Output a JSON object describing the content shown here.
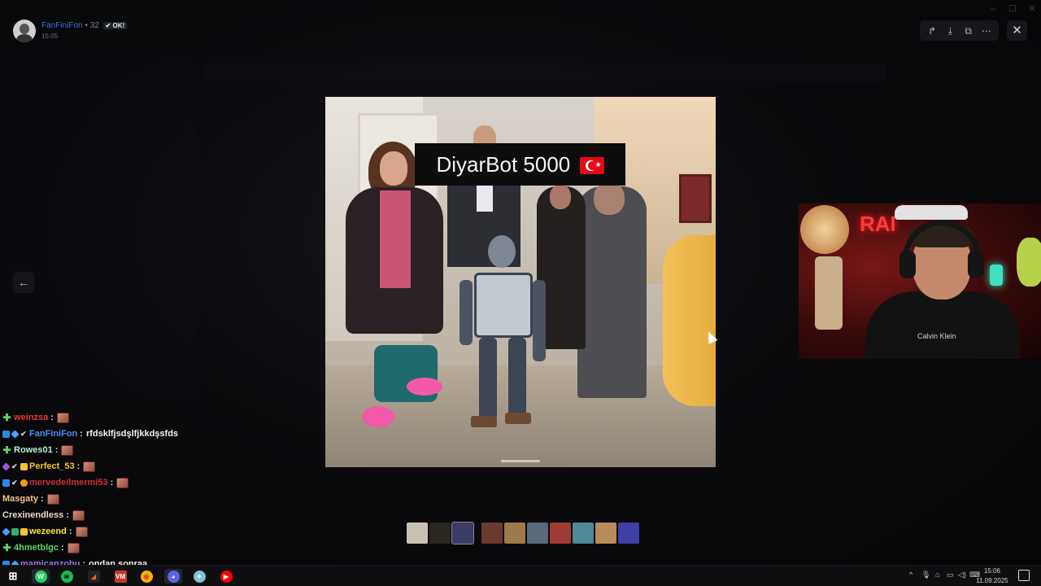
{
  "window": {
    "minimize_label": "–",
    "maximize_label": "☐",
    "close_label": "✕"
  },
  "viewer": {
    "poster_name": "FanFiniFon",
    "poster_sep": "•",
    "poster_points": "32",
    "poster_badge": "OK!",
    "post_time": "15:05",
    "toolbar_icons": [
      "share-icon",
      "download-icon",
      "open-external-icon",
      "more-icon"
    ],
    "toolbar_glyphs": [
      "↱",
      "⤓",
      "⧉",
      "⋯"
    ],
    "close_glyph": "✕",
    "prev_glyph": "←",
    "caption": "DiyarBot 5000"
  },
  "webcam": {
    "neon_text": "RAI",
    "shirt_logo": "Calvin Klein"
  },
  "thumbnails": [
    {
      "color": "#c9c2b3",
      "gap": false,
      "selected": false
    },
    {
      "color": "#2a2620",
      "gap": false,
      "selected": false
    },
    {
      "color": "#3b3c63",
      "gap": false,
      "selected": true
    },
    {
      "color": "#6b3a2e",
      "gap": true,
      "selected": false
    },
    {
      "color": "#9c7a4a",
      "gap": false,
      "selected": false
    },
    {
      "color": "#5a6a78",
      "gap": false,
      "selected": false
    },
    {
      "color": "#a13a3a",
      "gap": false,
      "selected": false
    },
    {
      "color": "#4e8a9a",
      "gap": false,
      "selected": false
    },
    {
      "color": "#b58c5a",
      "gap": false,
      "selected": false
    },
    {
      "color": "#3f3fa8",
      "gap": false,
      "selected": false
    }
  ],
  "chat": [
    {
      "badges": [
        "plus"
      ],
      "name": "weinzsa",
      "color": "#e8373d",
      "message": "",
      "emote": true
    },
    {
      "badges": [
        "blue",
        "cube",
        "check"
      ],
      "name": "FanFiniFon",
      "color": "#4a8df5",
      "message": "rfdsklfjsdşlfjkkdşsfds",
      "emote": false
    },
    {
      "badges": [
        "plus"
      ],
      "name": "Rowes01",
      "color": "#b5f2d7",
      "message": "",
      "emote": true
    },
    {
      "badges": [
        "purple",
        "check",
        "gold"
      ],
      "name": "Perfect_53",
      "color": "#f3c330",
      "message": "",
      "emote": true
    },
    {
      "badges": [
        "blue",
        "check",
        "orange"
      ],
      "name": "mervedeilmermi53",
      "color": "#d12d3b",
      "message": "",
      "emote": true
    },
    {
      "badges": [],
      "name": "Masgaty",
      "color": "#f3c38a",
      "message": "",
      "emote": true
    },
    {
      "badges": [],
      "name": "Crexinendless",
      "color": "#e9dcc8",
      "message": "",
      "emote": true
    },
    {
      "badges": [
        "cube",
        "green",
        "gold"
      ],
      "name": "wezeend",
      "color": "#f5e63b",
      "message": "",
      "emote": true
    },
    {
      "badges": [
        "plus"
      ],
      "name": "4hmetblgc",
      "color": "#5fd35f",
      "message": "",
      "emote": true
    },
    {
      "badges": [
        "blue",
        "cube"
      ],
      "name": "mamicanzobu",
      "color": "#9b7bf0",
      "message": "ondan sonraa",
      "emote": false
    }
  ],
  "taskbar": {
    "items": [
      {
        "name": "start-button",
        "glyph": "⊞",
        "bg": "transparent",
        "fg": "#ffffff",
        "active": false
      },
      {
        "name": "whatsapp-icon",
        "glyph": "W",
        "bg": "#25d366",
        "fg": "#ffffff",
        "active": true
      },
      {
        "name": "spotify-icon",
        "glyph": "≋",
        "bg": "#1db954",
        "fg": "#000000",
        "active": false
      },
      {
        "name": "capcut-icon",
        "glyph": "◢",
        "bg": "#222222",
        "fg": "#ff5a2a",
        "active": false
      },
      {
        "name": "voicemeeter-icon",
        "glyph": "VM",
        "bg": "#c0392b",
        "fg": "#ffffff",
        "active": false
      },
      {
        "name": "chrome-icon",
        "glyph": "◉",
        "bg": "#f4b400",
        "fg": "#db4437",
        "active": false
      },
      {
        "name": "discord-icon",
        "glyph": "◕",
        "bg": "#5865f2",
        "fg": "#ffffff",
        "active": true
      },
      {
        "name": "app-icon",
        "glyph": "✦",
        "bg": "#7cc4d8",
        "fg": "#ffffff",
        "active": false
      },
      {
        "name": "youtube-icon",
        "glyph": "▶",
        "bg": "#ff0000",
        "fg": "#ffffff",
        "active": false
      }
    ],
    "tray_glyphs": [
      "^",
      "🎙",
      "⌂",
      "▭",
      "◁)",
      "⌨"
    ],
    "clock_time": "15:06",
    "clock_date": "11.09.2025"
  }
}
